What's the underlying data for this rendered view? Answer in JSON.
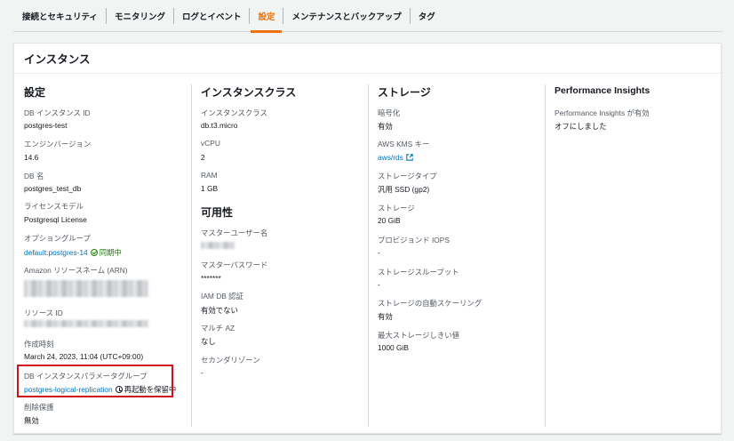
{
  "tabs": [
    {
      "label": "接続とセキュリティ",
      "active": false
    },
    {
      "label": "モニタリング",
      "active": false
    },
    {
      "label": "ログとイベント",
      "active": false
    },
    {
      "label": "設定",
      "active": true
    },
    {
      "label": "メンテナンスとバックアップ",
      "active": false
    },
    {
      "label": "タグ",
      "active": false
    }
  ],
  "panel": {
    "title": "インスタンス"
  },
  "config": {
    "title": "設定",
    "db_instance_id_label": "DB インスタンス ID",
    "db_instance_id": "postgres-test",
    "engine_version_label": "エンジンバージョン",
    "engine_version": "14.6",
    "db_name_label": "DB 名",
    "db_name": "postgres_test_db",
    "license_model_label": "ライセンスモデル",
    "license_model": "Postgresql License",
    "option_group_label": "オプショングループ",
    "option_group": "default:postgres-14",
    "option_group_status": "同期中",
    "arn_label": "Amazon リソースネーム (ARN)",
    "resource_id_label": "リソース ID",
    "created_label": "作成時刻",
    "created": "March 24, 2023, 11:04 (UTC+09:00)",
    "param_group_label": "DB インスタンスパラメータグループ",
    "param_group": "postgres-logical-replication",
    "param_group_status": "再起動を保留中",
    "deletion_protection_label": "削除保護",
    "deletion_protection": "無効"
  },
  "instance_class": {
    "title": "インスタンスクラス",
    "class_label": "インスタンスクラス",
    "class": "db.t3.micro",
    "vcpu_label": "vCPU",
    "vcpu": "2",
    "ram_label": "RAM",
    "ram": "1 GB"
  },
  "availability": {
    "title": "可用性",
    "master_user_label": "マスターユーザー名",
    "master_password_label": "マスターパスワード",
    "master_password": "*******",
    "iam_auth_label": "IAM DB 認証",
    "iam_auth": "有効でない",
    "multi_az_label": "マルチ AZ",
    "multi_az": "なし",
    "secondary_zone_label": "セカンダリゾーン",
    "secondary_zone": "-"
  },
  "storage": {
    "title": "ストレージ",
    "encryption_label": "暗号化",
    "encryption": "有効",
    "kms_label": "AWS KMS キー",
    "kms": "aws/rds",
    "storage_type_label": "ストレージタイプ",
    "storage_type": "汎用 SSD (gp2)",
    "storage_label": "ストレージ",
    "storage": "20 GiB",
    "iops_label": "プロビジョンド IOPS",
    "iops": "-",
    "throughput_label": "ストレージスループット",
    "throughput": "-",
    "autoscaling_label": "ストレージの自動スケーリング",
    "autoscaling": "有効",
    "max_threshold_label": "最大ストレージしきい値",
    "max_threshold": "1000 GiB"
  },
  "performance": {
    "title": "Performance Insights",
    "enabled_label": "Performance Insights が有効",
    "enabled": "オフにしました"
  },
  "colors": {
    "accent": "#ec7211",
    "link": "#0073bb",
    "success": "#1d8102",
    "highlight": "#d0121b"
  }
}
